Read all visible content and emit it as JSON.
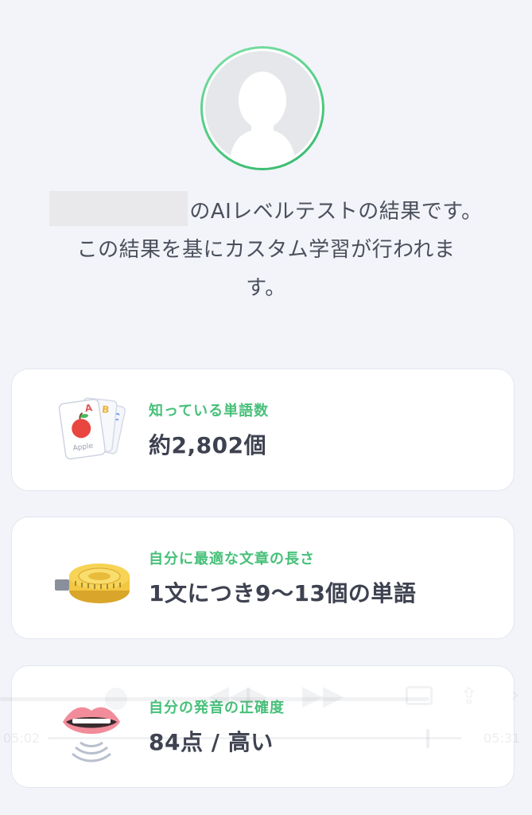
{
  "profile": {
    "avatar_icon": "user-silhouette-icon",
    "accent_color": "#4cca7f"
  },
  "intro": {
    "line1_suffix": "のAIレベルテストの結果です。",
    "line2": "この結果を基にカスタム学習が行われま",
    "line3": "す。"
  },
  "results": [
    {
      "label": "知っている単語数",
      "value": "約2,802個",
      "icon": "flashcards-icon"
    },
    {
      "label": "自分に最適な文章の長さ",
      "value": "1文につき9〜13個の単語",
      "icon": "tape-measure-icon"
    },
    {
      "label": "自分の発音の正確度",
      "value": "84点 / 高い",
      "icon": "mouth-speaking-icon"
    }
  ],
  "media_overlay": {
    "time_elapsed": "05:02",
    "time_total": "05:31"
  },
  "colors": {
    "background": "#f2f4f9",
    "card": "#ffffff",
    "label_green": "#47c07a",
    "value_text": "#3e4250"
  }
}
